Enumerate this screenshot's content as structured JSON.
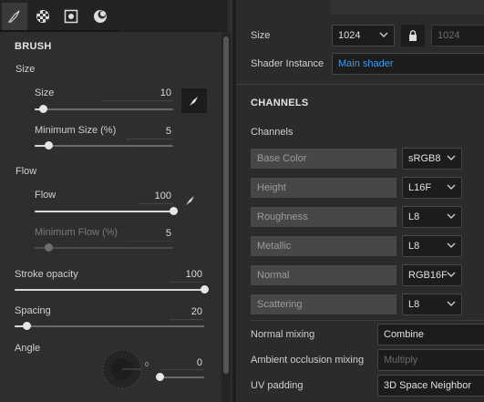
{
  "left": {
    "tabs": [
      {
        "name": "brush-tab",
        "icon": "brush-icon"
      },
      {
        "name": "alpha-tab",
        "icon": "checker-icon"
      },
      {
        "name": "stencil-tab",
        "icon": "stencil-icon"
      },
      {
        "name": "material-tab",
        "icon": "material-icon"
      }
    ],
    "brush_header": "BRUSH",
    "size_group": "Size",
    "size_label": "Size",
    "size_value": "10",
    "min_size_label": "Minimum Size (%)",
    "min_size_value": "5",
    "flow_group": "Flow",
    "flow_label": "Flow",
    "flow_value": "100",
    "min_flow_label": "Minimum Flow (%)",
    "min_flow_value": "5",
    "stroke_opacity_label": "Stroke opacity",
    "stroke_opacity_value": "100",
    "spacing_label": "Spacing",
    "spacing_value": "20",
    "angle_label": "Angle",
    "angle_dial_value": "0",
    "angle_value": "0",
    "sliders": {
      "size": 0.1,
      "min_size": 0.05,
      "flow": 1.0,
      "min_flow": 0.05,
      "stroke_opacity": 1.0,
      "spacing": 0.05,
      "angle": 0.0
    }
  },
  "right": {
    "size_label": "Size",
    "size_select": "1024",
    "size_locked_value": "1024",
    "shader_label": "Shader Instance",
    "shader_value": "Main shader",
    "channels_header": "CHANNELS",
    "channels_label": "Channels",
    "channels": [
      {
        "name": "Base Color",
        "format": "sRGB8"
      },
      {
        "name": "Height",
        "format": "L16F"
      },
      {
        "name": "Roughness",
        "format": "L8"
      },
      {
        "name": "Metallic",
        "format": "L8"
      },
      {
        "name": "Normal",
        "format": "RGB16F"
      },
      {
        "name": "Scattering",
        "format": "L8"
      }
    ],
    "normal_mixing_label": "Normal mixing",
    "normal_mixing_value": "Combine",
    "ao_mixing_label": "Ambient occlusion mixing",
    "ao_mixing_value": "Multiply",
    "uv_padding_label": "UV padding",
    "uv_padding_value": "3D Space Neighbor"
  },
  "colors": {
    "accent_link": "#3d9be9",
    "panel": "#2e2e2e",
    "field": "#1c1c1c"
  }
}
